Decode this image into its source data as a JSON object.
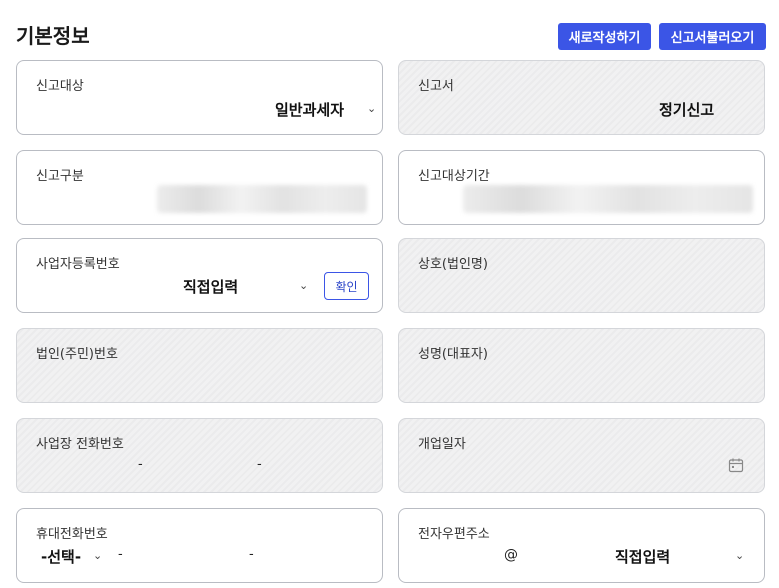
{
  "header": {
    "title": "기본정보",
    "new_button": "새로작성하기",
    "load_button": "신고서불러오기"
  },
  "fields": {
    "report_target": {
      "label": "신고대상",
      "value": "일반과세자"
    },
    "report_form": {
      "label": "신고서",
      "value": "정기신고"
    },
    "report_type": {
      "label": "신고구분"
    },
    "report_period": {
      "label": "신고대상기간"
    },
    "business_number": {
      "label": "사업자등록번호",
      "select_value": "직접입력",
      "confirm_button": "확인"
    },
    "company_name": {
      "label": "상호(법인명)"
    },
    "corp_number": {
      "label": "법인(주민)번호"
    },
    "rep_name": {
      "label": "성명(대표자)"
    },
    "business_phone": {
      "label": "사업장 전화번호",
      "sep1": "-",
      "sep2": "-"
    },
    "open_date": {
      "label": "개업일자"
    },
    "mobile_phone": {
      "label": "휴대전화번호",
      "prefix": "-선택-",
      "sep1": "-",
      "sep2": "-"
    },
    "email": {
      "label": "전자우편주소",
      "at": "@",
      "domain_select": "직접입력"
    }
  },
  "icons": {
    "chevron": "chevron-down-icon",
    "calendar": "calendar-icon"
  },
  "colors": {
    "accent": "#3b55e6",
    "readonly_bg": "#eeeeef",
    "border": "#b9bcc3"
  }
}
